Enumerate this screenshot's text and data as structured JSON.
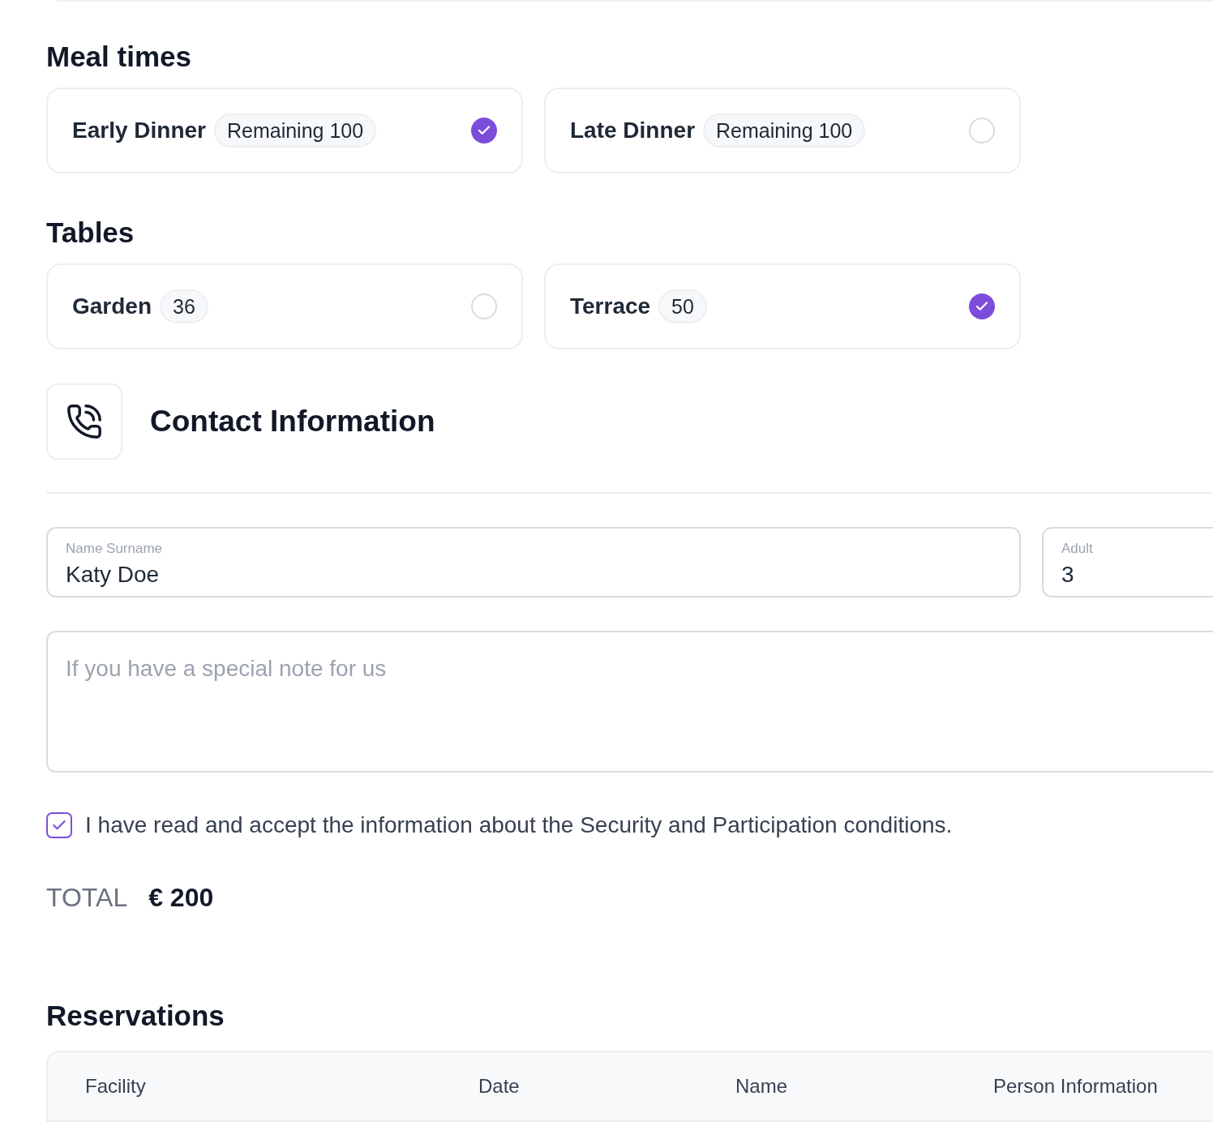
{
  "meal_times": {
    "title": "Meal times",
    "options": [
      {
        "label": "Early Dinner",
        "badge": "Remaining 100",
        "selected": true
      },
      {
        "label": "Late Dinner",
        "badge": "Remaining 100",
        "selected": false
      }
    ]
  },
  "tables": {
    "title": "Tables",
    "options": [
      {
        "label": "Garden",
        "badge": "36",
        "selected": false
      },
      {
        "label": "Terrace",
        "badge": "50",
        "selected": true
      }
    ]
  },
  "contact": {
    "title": "Contact Information"
  },
  "fields": {
    "name": {
      "label": "Name Surname",
      "value": "Katy Doe"
    },
    "adult": {
      "label": "Adult",
      "value": "3"
    }
  },
  "note": {
    "placeholder": "If you have a special note for us"
  },
  "consent": {
    "text": "I have read and accept the information about the Security and Participation conditions.",
    "checked": true
  },
  "total": {
    "label": "TOTAL",
    "value": "€ 200"
  },
  "reservations": {
    "title": "Reservations",
    "columns": [
      "Facility",
      "Date",
      "Name",
      "Person Information"
    ]
  }
}
